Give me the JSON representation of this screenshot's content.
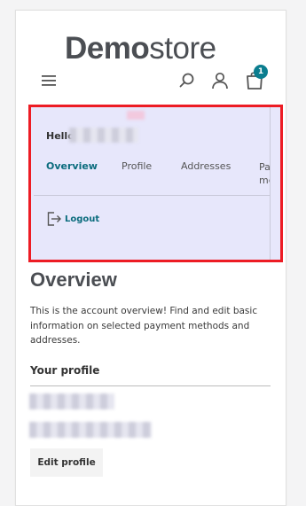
{
  "header": {
    "logo_bold": "Demo",
    "logo_light": "store",
    "cart_count": "1"
  },
  "account": {
    "greeting": "Hello",
    "tabs": [
      {
        "label": "Overview",
        "active": true
      },
      {
        "label": "Profile",
        "active": false
      },
      {
        "label": "Addresses",
        "active": false
      },
      {
        "label": "Payment methods",
        "active": false
      }
    ],
    "logout_label": "Logout"
  },
  "main": {
    "title": "Overview",
    "intro": "This is the account overview! Find and edit basic information on selected payment methods and addresses.",
    "profile_section_title": "Your profile",
    "edit_profile_label": "Edit profile"
  },
  "colors": {
    "accent": "#0b6c7d",
    "badge": "#0b7d8f",
    "highlight_border": "#ed1c24",
    "panel_bg": "#e7e7fb"
  }
}
